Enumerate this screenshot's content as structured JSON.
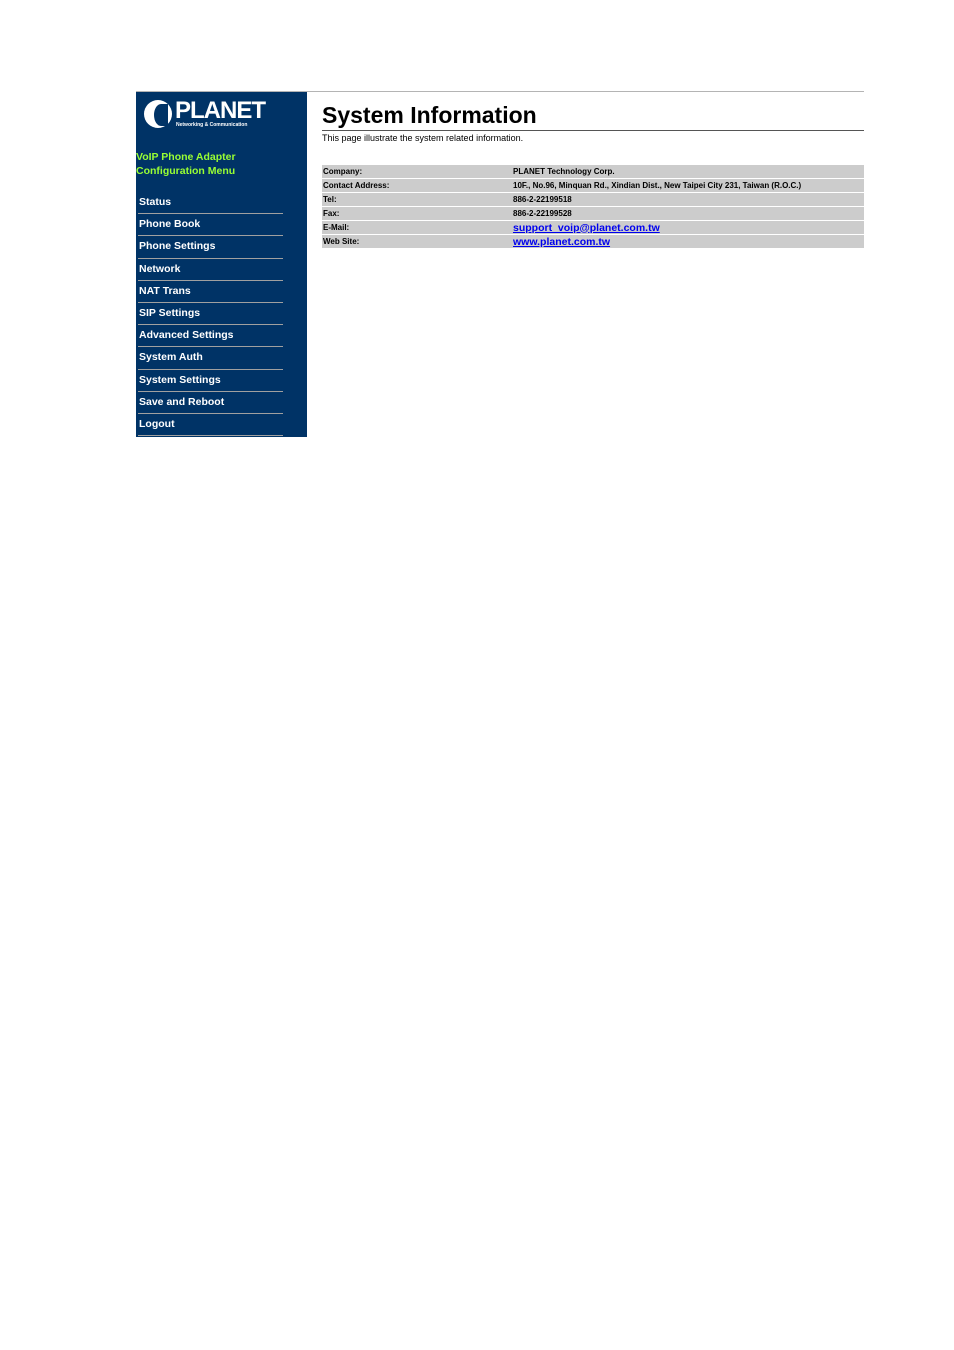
{
  "sidebar": {
    "logo": {
      "name": "PLANET",
      "tagline": "Networking & Communication"
    },
    "menu_title_line1": "VoIP Phone Adapter",
    "menu_title_line2": "Configuration Menu",
    "items": [
      {
        "label": "Status"
      },
      {
        "label": "Phone Book"
      },
      {
        "label": "Phone Settings"
      },
      {
        "label": "Network"
      },
      {
        "label": "NAT Trans"
      },
      {
        "label": "SIP Settings"
      },
      {
        "label": "Advanced Settings"
      },
      {
        "label": "System Auth"
      },
      {
        "label": "System Settings"
      },
      {
        "label": "Save and Reboot"
      },
      {
        "label": "Logout"
      }
    ]
  },
  "main": {
    "title": "System Information",
    "description": "This page illustrate the system related information.",
    "rows": [
      {
        "label": "Company:",
        "value": "PLANET Technology Corp."
      },
      {
        "label": "Contact Address:",
        "value": "10F., No.96, Minquan Rd., Xindian Dist., New Taipei City 231, Taiwan (R.O.C.)"
      },
      {
        "label": "Tel:",
        "value": "886-2-22199518"
      },
      {
        "label": "Fax:",
        "value": "886-2-22199528"
      },
      {
        "label": "E-Mail:",
        "value": "support_voip@planet.com.tw"
      },
      {
        "label": "Web Site:",
        "value": "www.planet.com.tw"
      }
    ]
  },
  "colors": {
    "sidebar_bg": "#003366",
    "menu_title": "#99ff33",
    "row_bg": "#cccccc",
    "link": "#0000ee"
  }
}
